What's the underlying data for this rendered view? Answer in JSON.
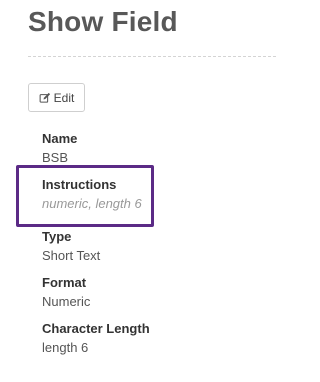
{
  "page_title": "Show Field",
  "toolbar": {
    "edit_label": "Edit",
    "edit_icon": "edit-icon"
  },
  "fields": [
    {
      "label": "Name",
      "value": "BSB"
    },
    {
      "label": "Instructions",
      "value": "numeric, length 6"
    },
    {
      "label": "Type",
      "value": "Short Text"
    },
    {
      "label": "Format",
      "value": "Numeric"
    },
    {
      "label": "Character Length",
      "value": "length 6"
    }
  ],
  "colors": {
    "highlight": "#5b2a86",
    "title": "#585858",
    "muted": "#999999"
  }
}
